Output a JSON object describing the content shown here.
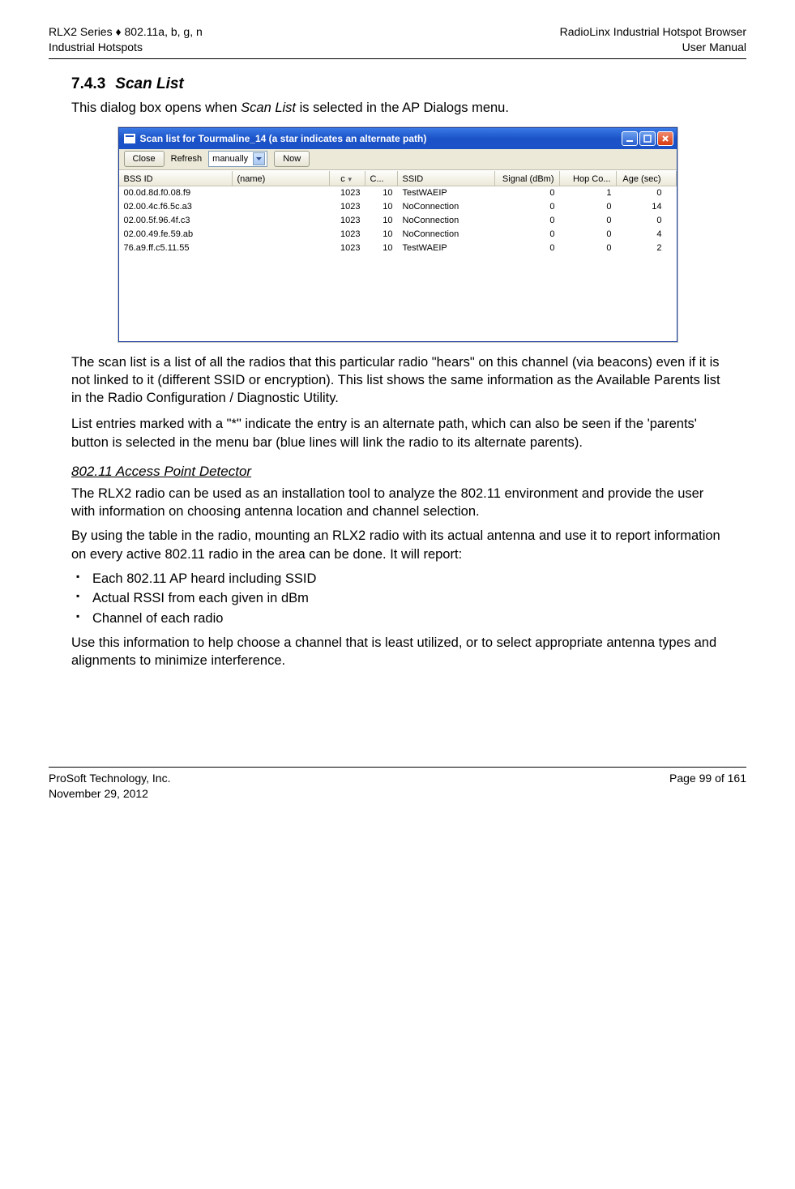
{
  "header": {
    "left_line1": "RLX2 Series ♦ 802.11a, b, g, n",
    "left_line2": "Industrial Hotspots",
    "right_line1": "RadioLinx Industrial Hotspot Browser",
    "right_line2": "User Manual"
  },
  "section": {
    "number": "7.4.3",
    "title": "Scan List"
  },
  "intro": {
    "pre": "This dialog box opens when ",
    "em": "Scan List",
    "post": " is selected in the AP Dialogs menu."
  },
  "window": {
    "title": "Scan list for Tourmaline_14 (a star indicates an alternate path)",
    "toolbar": {
      "close": "Close",
      "refresh_label": "Refresh",
      "refresh_value": "manually",
      "now": "Now"
    },
    "columns": {
      "bss": "BSS ID",
      "name": "(name)",
      "c1": "c",
      "c2": "C...",
      "ssid": "SSID",
      "signal": "Signal (dBm)",
      "hop": "Hop Co...",
      "age": "Age (sec)"
    },
    "rows": [
      {
        "bss": "00.0d.8d.f0.08.f9",
        "name": "",
        "c1": "1023",
        "c2": "10",
        "ssid": "TestWAEIP",
        "sig": "0",
        "hop": "1",
        "age": "0"
      },
      {
        "bss": "02.00.4c.f6.5c.a3",
        "name": "",
        "c1": "1023",
        "c2": "10",
        "ssid": "NoConnection",
        "sig": "0",
        "hop": "0",
        "age": "14"
      },
      {
        "bss": "02.00.5f.96.4f.c3",
        "name": "",
        "c1": "1023",
        "c2": "10",
        "ssid": "NoConnection",
        "sig": "0",
        "hop": "0",
        "age": "0"
      },
      {
        "bss": "02.00.49.fe.59.ab",
        "name": "",
        "c1": "1023",
        "c2": "10",
        "ssid": "NoConnection",
        "sig": "0",
        "hop": "0",
        "age": "4"
      },
      {
        "bss": "76.a9.ff.c5.11.55",
        "name": "",
        "c1": "1023",
        "c2": "10",
        "ssid": "TestWAEIP",
        "sig": "0",
        "hop": "0",
        "age": "2"
      }
    ]
  },
  "body": {
    "p1": "The scan list is a list of all the radios that this particular radio \"hears\" on this channel (via beacons) even if it is not linked to it (different SSID or encryption). This list shows the same information as the Available Parents list in the Radio Configuration / Diagnostic Utility.",
    "p2": "List entries marked with a \"*\" indicate the entry is an alternate path, which can also be seen if the 'parents' button is selected in the menu bar (blue lines will link the radio to its alternate parents).",
    "sub_title": "802.11 Access Point Detector",
    "p3": "The RLX2 radio can be used as an installation tool to analyze the 802.11 environment and provide the user with information on choosing antenna location and channel selection.",
    "p4": "By using the table in the radio, mounting an RLX2 radio with its actual antenna and use it to report information on every active 802.11 radio in the area can be done. It will report:",
    "bullets": [
      "Each 802.11 AP heard including SSID",
      "Actual RSSI from each given in dBm",
      "Channel of each radio"
    ],
    "p5": "Use this information to help choose a channel that is least utilized, or to select appropriate antenna types and alignments to minimize interference."
  },
  "footer": {
    "left_line1": "ProSoft Technology, Inc.",
    "left_line2": "November 29, 2012",
    "right_line1": "Page 99 of 161"
  }
}
